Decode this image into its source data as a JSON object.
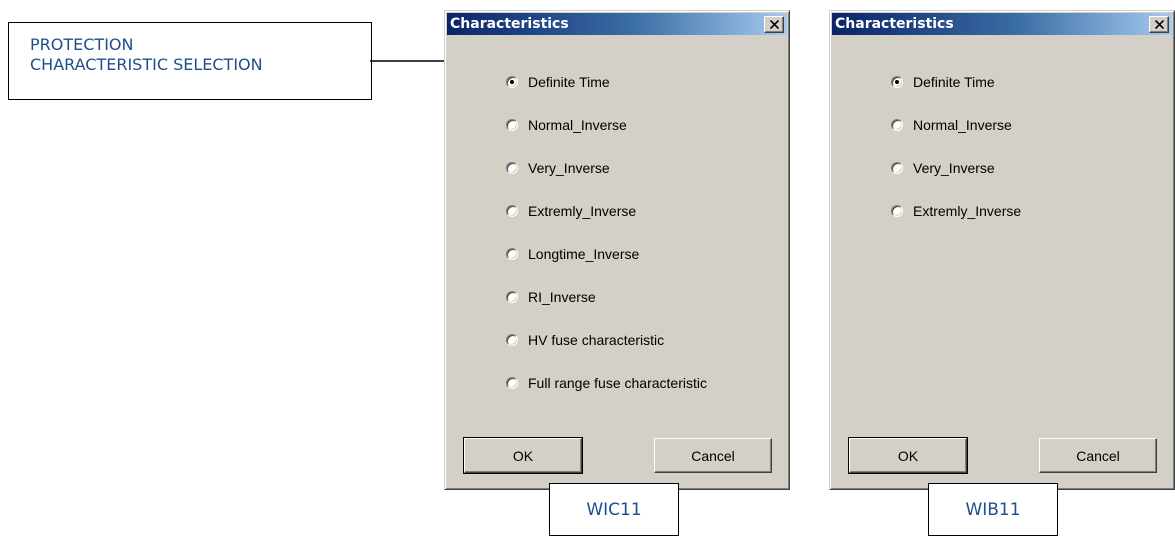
{
  "callout": {
    "line1": "PROTECTION",
    "line2": "CHARACTERISTIC SELECTION"
  },
  "dialogs": [
    {
      "title": "Characteristics",
      "caption": "WIC11",
      "selected": "Definite Time",
      "options": [
        "Definite Time",
        "Normal_Inverse",
        "Very_Inverse",
        "Extremly_Inverse",
        "Longtime_Inverse",
        "RI_Inverse",
        "HV fuse characteristic",
        "Full range fuse characteristic"
      ],
      "ok_label": "OK",
      "cancel_label": "Cancel"
    },
    {
      "title": "Characteristics",
      "caption": "WIB11",
      "selected": "Definite Time",
      "options": [
        "Definite Time",
        "Normal_Inverse",
        "Very_Inverse",
        "Extremly_Inverse"
      ],
      "ok_label": "OK",
      "cancel_label": "Cancel"
    }
  ],
  "colors": {
    "callout_text": "#1f4e8c",
    "titlebar_start": "#0a246a",
    "titlebar_end": "#a6caf0",
    "dialog_face": "#d4d0c8"
  }
}
